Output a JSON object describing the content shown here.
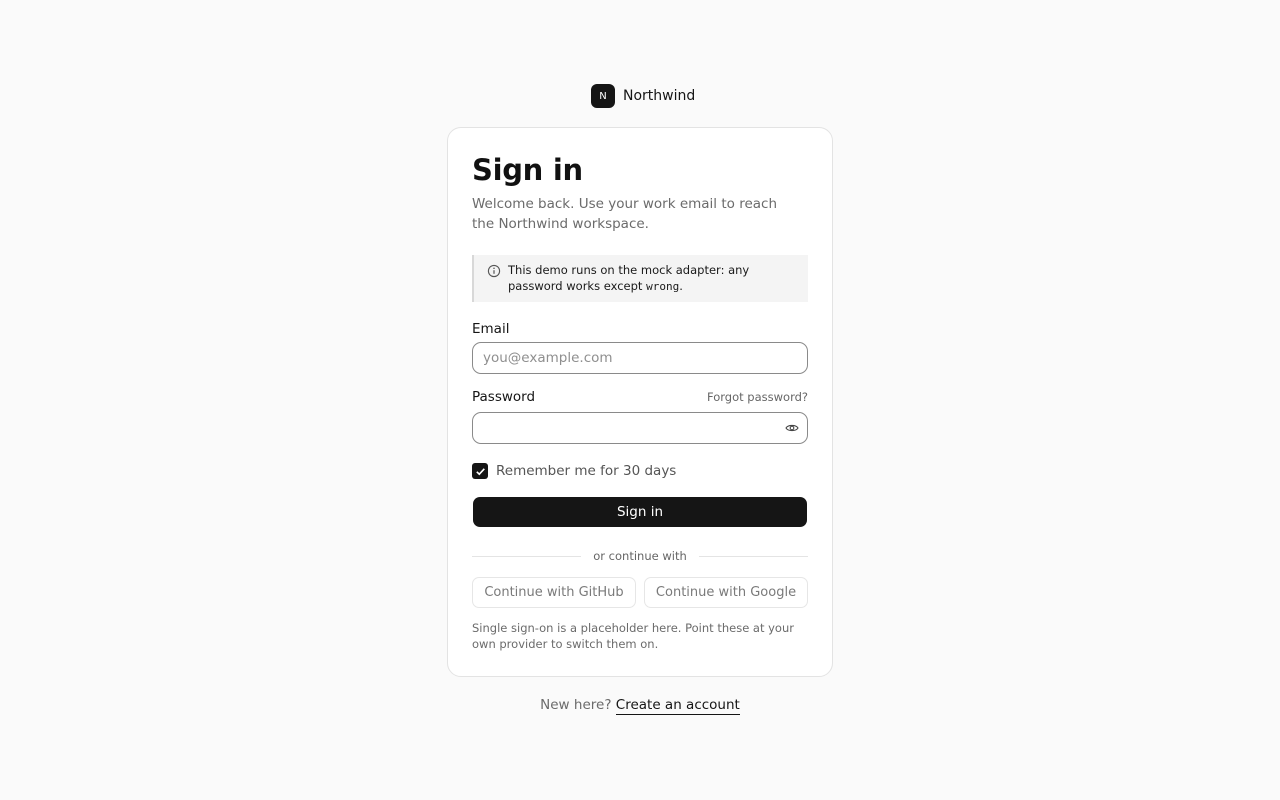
{
  "brand": {
    "mark": "N",
    "name": "Northwind"
  },
  "card": {
    "title": "Sign in",
    "subtitle": "Welcome back. Use your work email to reach the Northwind workspace.",
    "notice": {
      "icon": "info-icon",
      "text_before": "This demo runs on the mock adapter: any password works except ",
      "code": "wrong",
      "text_after": "."
    },
    "email": {
      "label": "Email",
      "placeholder": "you@example.com",
      "value": ""
    },
    "password": {
      "label": "Password",
      "forgot_label": "Forgot password?",
      "value": "",
      "toggle_icon": "eye-icon"
    },
    "remember": {
      "label": "Remember me for 30 days",
      "checked": true
    },
    "submit_label": "Sign in",
    "divider_text": "or continue with",
    "sso": {
      "github_label": "Continue with GitHub",
      "google_label": "Continue with Google"
    },
    "sso_note": "Single sign-on is a placeholder here. Point these at your own provider to switch them on."
  },
  "footer": {
    "prompt": "New here?",
    "link_label": "Create an account"
  },
  "colors": {
    "primary": "#151515",
    "background": "#fafafa",
    "muted_text": "#6b6b6b"
  }
}
